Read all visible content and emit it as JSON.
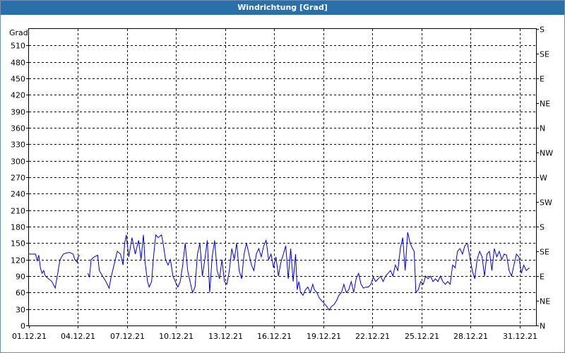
{
  "window": {
    "title": "Windrichtung [Grad]"
  },
  "colors": {
    "titlebar": "#2a6fa8",
    "series": "#0000c8",
    "grid": "#000000"
  },
  "chart_data": {
    "type": "line",
    "title": "Windrichtung [Grad]",
    "ylabel": "Grad",
    "ylim": [
      0,
      540
    ],
    "y_ticks": [
      0,
      30,
      60,
      90,
      120,
      150,
      180,
      210,
      240,
      270,
      300,
      330,
      360,
      390,
      420,
      450,
      480,
      510
    ],
    "y2_ticks": [
      {
        "value": 0,
        "label": "N"
      },
      {
        "value": 45,
        "label": "NE"
      },
      {
        "value": 90,
        "label": "E"
      },
      {
        "value": 135,
        "label": "SE"
      },
      {
        "value": 180,
        "label": "S"
      },
      {
        "value": 225,
        "label": "SW"
      },
      {
        "value": 270,
        "label": "W"
      },
      {
        "value": 315,
        "label": "NW"
      },
      {
        "value": 360,
        "label": "N"
      },
      {
        "value": 405,
        "label": "NE"
      },
      {
        "value": 450,
        "label": "E"
      },
      {
        "value": 495,
        "label": "SE"
      },
      {
        "value": 540,
        "label": "S"
      }
    ],
    "xlim": [
      1,
      32
    ],
    "x_ticks": [
      {
        "day": 1,
        "label": "01.12.21"
      },
      {
        "day": 4,
        "label": "04.12.21"
      },
      {
        "day": 7,
        "label": "07.12.21"
      },
      {
        "day": 10,
        "label": "10.12.21"
      },
      {
        "day": 13,
        "label": "13.12.21"
      },
      {
        "day": 16,
        "label": "16.12.21"
      },
      {
        "day": 19,
        "label": "19.12.21"
      },
      {
        "day": 22,
        "label": "22.12.21"
      },
      {
        "day": 25,
        "label": "25.12.21"
      },
      {
        "day": 28,
        "label": "28.12.21"
      },
      {
        "day": 31,
        "label": "31.12.21"
      }
    ],
    "grid": true,
    "series": [
      {
        "segments": [
          [
            [
              1.0,
              130
            ],
            [
              1.4,
              130
            ],
            [
              1.5,
              118
            ],
            [
              1.6,
              128
            ],
            [
              1.7,
              105
            ],
            [
              1.8,
              95
            ],
            [
              1.9,
              100
            ],
            [
              2.0,
              90
            ],
            [
              2.2,
              85
            ],
            [
              2.4,
              80
            ],
            [
              2.6,
              68
            ],
            [
              2.7,
              85
            ],
            [
              2.9,
              120
            ],
            [
              3.1,
              130
            ],
            [
              3.3,
              132
            ],
            [
              3.5,
              133
            ],
            [
              3.7,
              130
            ],
            [
              3.8,
              120
            ],
            [
              3.95,
              115
            ],
            [
              4.0,
              125
            ],
            [
              4.1,
              128
            ]
          ],
          [
            [
              4.6,
              95
            ],
            [
              4.7,
              88
            ],
            [
              4.8,
              120
            ],
            [
              5.0,
              125
            ],
            [
              5.2,
              128
            ],
            [
              5.3,
              100
            ],
            [
              5.5,
              90
            ],
            [
              5.7,
              80
            ],
            [
              5.9,
              68
            ],
            [
              6.0,
              85
            ],
            [
              6.2,
              110
            ],
            [
              6.4,
              135
            ],
            [
              6.6,
              130
            ],
            [
              6.75,
              110
            ],
            [
              6.85,
              150
            ],
            [
              6.95,
              165
            ],
            [
              7.1,
              125
            ],
            [
              7.3,
              160
            ],
            [
              7.5,
              130
            ],
            [
              7.7,
              155
            ],
            [
              7.85,
              120
            ],
            [
              8.0,
              165
            ],
            [
              8.1,
              115
            ],
            [
              8.25,
              80
            ],
            [
              8.35,
              70
            ],
            [
              8.5,
              80
            ],
            [
              8.6,
              120
            ],
            [
              8.75,
              165
            ],
            [
              8.9,
              160
            ],
            [
              9.1,
              165
            ],
            [
              9.2,
              150
            ],
            [
              9.35,
              120
            ],
            [
              9.5,
              110
            ],
            [
              9.65,
              120
            ],
            [
              9.8,
              90
            ],
            [
              9.95,
              80
            ],
            [
              10.1,
              70
            ],
            [
              10.25,
              80
            ],
            [
              10.4,
              110
            ],
            [
              10.55,
              150
            ],
            [
              10.7,
              100
            ],
            [
              10.85,
              80
            ],
            [
              11.0,
              60
            ],
            [
              11.15,
              70
            ],
            [
              11.3,
              130
            ],
            [
              11.45,
              150
            ],
            [
              11.6,
              90
            ],
            [
              11.75,
              120
            ],
            [
              11.9,
              155
            ],
            [
              12.05,
              60
            ],
            [
              12.2,
              125
            ],
            [
              12.35,
              155
            ],
            [
              12.5,
              100
            ],
            [
              12.65,
              85
            ],
            [
              12.8,
              120
            ],
            [
              12.95,
              80
            ],
            [
              13.1,
              75
            ],
            [
              13.25,
              100
            ],
            [
              13.4,
              140
            ],
            [
              13.55,
              120
            ],
            [
              13.7,
              150
            ],
            [
              13.85,
              100
            ],
            [
              14.0,
              85
            ],
            [
              14.15,
              130
            ],
            [
              14.3,
              150
            ],
            [
              14.45,
              130
            ],
            [
              14.6,
              110
            ],
            [
              14.75,
              100
            ],
            [
              14.9,
              130
            ],
            [
              15.05,
              140
            ],
            [
              15.2,
              125
            ],
            [
              15.35,
              145
            ],
            [
              15.5,
              155
            ],
            [
              15.65,
              120
            ],
            [
              15.8,
              130
            ],
            [
              15.95,
              105
            ],
            [
              16.1,
              125
            ],
            [
              16.25,
              90
            ],
            [
              16.4,
              115
            ],
            [
              16.55,
              130
            ],
            [
              16.7,
              145
            ],
            [
              16.85,
              85
            ],
            [
              17.0,
              140
            ],
            [
              17.15,
              80
            ],
            [
              17.3,
              130
            ],
            [
              17.4,
              65
            ],
            [
              17.5,
              80
            ],
            [
              17.6,
              60
            ],
            [
              17.75,
              55
            ],
            [
              17.9,
              65
            ],
            [
              18.05,
              70
            ],
            [
              18.2,
              60
            ],
            [
              18.35,
              75
            ],
            [
              18.45,
              65
            ],
            [
              18.6,
              60
            ],
            [
              18.75,
              50
            ],
            [
              18.9,
              45
            ],
            [
              19.05,
              40
            ],
            [
              19.2,
              35
            ],
            [
              19.35,
              28
            ],
            [
              19.5,
              35
            ],
            [
              19.65,
              38
            ],
            [
              19.8,
              45
            ],
            [
              19.95,
              55
            ],
            [
              20.1,
              60
            ],
            [
              20.25,
              75
            ],
            [
              20.4,
              60
            ],
            [
              20.55,
              65
            ],
            [
              20.7,
              80
            ],
            [
              20.85,
              60
            ],
            [
              21.0,
              85
            ],
            [
              21.15,
              95
            ],
            [
              21.3,
              75
            ],
            [
              21.45,
              68
            ],
            [
              21.6,
              70
            ],
            [
              21.75,
              70
            ],
            [
              21.9,
              75
            ],
            [
              22.05,
              88
            ],
            [
              22.2,
              80
            ],
            [
              22.35,
              85
            ],
            [
              22.5,
              90
            ],
            [
              22.65,
              80
            ],
            [
              22.8,
              90
            ],
            [
              22.95,
              95
            ],
            [
              23.1,
              100
            ],
            [
              23.25,
              90
            ],
            [
              23.4,
              110
            ],
            [
              23.55,
              100
            ],
            [
              23.7,
              140
            ],
            [
              23.85,
              160
            ],
            [
              24.0,
              100
            ],
            [
              24.15,
              170
            ],
            [
              24.3,
              150
            ],
            [
              24.45,
              140
            ],
            [
              24.55,
              135
            ],
            [
              24.65,
              60
            ],
            [
              24.8,
              65
            ],
            [
              24.95,
              80
            ],
            [
              25.1,
              75
            ],
            [
              25.25,
              90
            ],
            [
              25.4,
              85
            ],
            [
              25.55,
              90
            ],
            [
              25.7,
              80
            ],
            [
              25.85,
              85
            ],
            [
              26.0,
              80
            ],
            [
              26.15,
              90
            ],
            [
              26.3,
              80
            ],
            [
              26.45,
              75
            ],
            [
              26.6,
              80
            ],
            [
              26.75,
              75
            ],
            [
              26.9,
              110
            ],
            [
              27.05,
              105
            ],
            [
              27.2,
              135
            ],
            [
              27.35,
              140
            ],
            [
              27.5,
              130
            ],
            [
              27.65,
              145
            ],
            [
              27.8,
              150
            ],
            [
              27.95,
              125
            ],
            [
              28.1,
              100
            ],
            [
              28.25,
              85
            ],
            [
              28.4,
              120
            ],
            [
              28.55,
              135
            ],
            [
              28.7,
              125
            ],
            [
              28.85,
              90
            ],
            [
              29.0,
              130
            ],
            [
              29.15,
              135
            ],
            [
              29.3,
              100
            ],
            [
              29.45,
              140
            ],
            [
              29.6,
              125
            ],
            [
              29.75,
              135
            ],
            [
              29.9,
              120
            ],
            [
              30.05,
              130
            ],
            [
              30.2,
              128
            ],
            [
              30.35,
              100
            ],
            [
              30.5,
              90
            ],
            [
              30.65,
              110
            ],
            [
              30.8,
              130
            ],
            [
              30.95,
              125
            ],
            [
              31.1,
              95
            ],
            [
              31.25,
              110
            ],
            [
              31.4,
              100
            ],
            [
              31.6,
              105
            ]
          ]
        ]
      }
    ]
  }
}
